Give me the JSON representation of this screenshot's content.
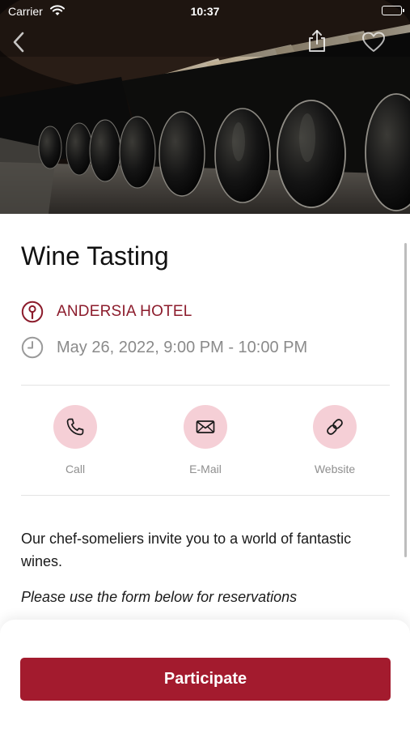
{
  "status_bar": {
    "carrier": "Carrier",
    "time": "10:37"
  },
  "nav": {
    "back_icon": "chevron-left-icon",
    "share_icon": "share-icon",
    "favorite_icon": "heart-icon"
  },
  "event": {
    "title": "Wine Tasting",
    "location": "ANDERSIA HOTEL",
    "datetime": "May 26, 2022, 9:00 PM - 10:00 PM",
    "description": "Our chef-someliers invite you to a world of fantastic wines.",
    "note": "Please use the form below for reservations"
  },
  "actions": [
    {
      "label": "Call",
      "icon": "phone-icon"
    },
    {
      "label": "E-Mail",
      "icon": "mail-icon"
    },
    {
      "label": "Website",
      "icon": "link-icon"
    }
  ],
  "cta": {
    "participate_label": "Participate"
  },
  "colors": {
    "accent": "#a31b2e",
    "location_text": "#8c1c2c",
    "action_circle": "#f5cfd6",
    "muted_text": "#8a8a8a"
  }
}
